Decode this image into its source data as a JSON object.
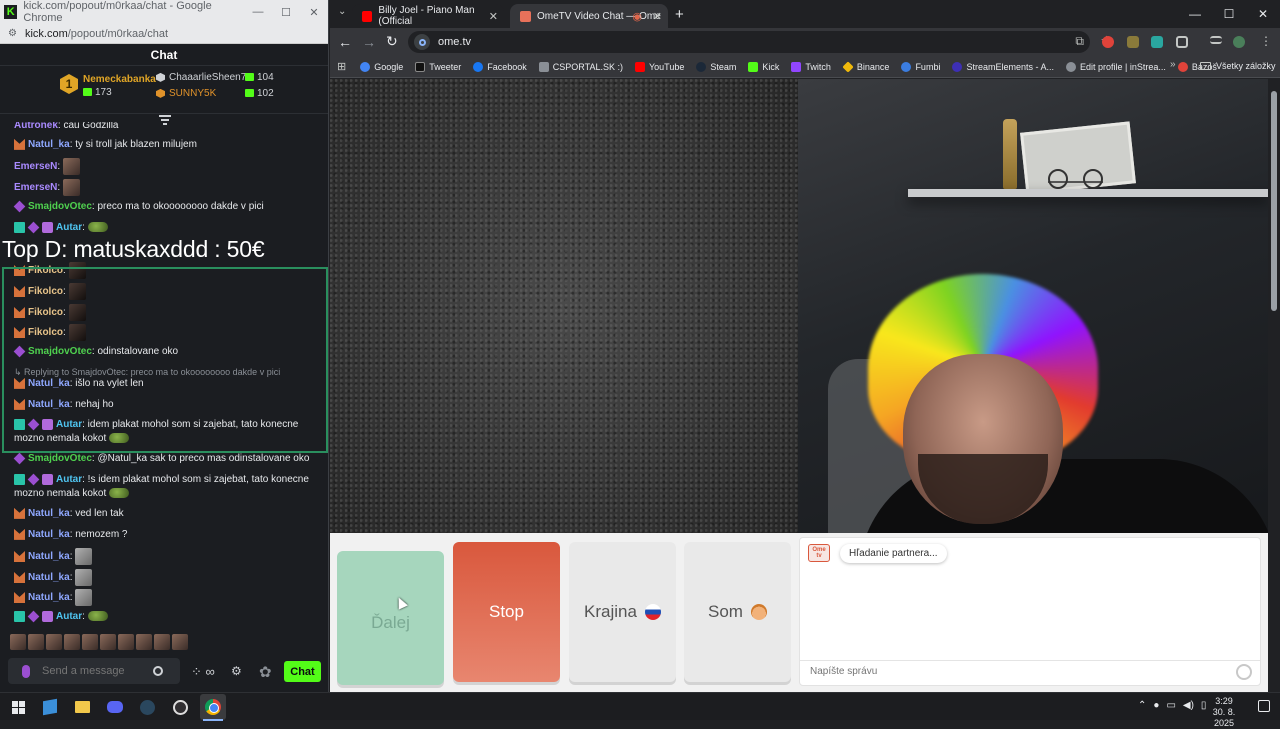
{
  "kick": {
    "window_title": "kick.com/popout/m0rkaa/chat - Google Chrome",
    "url_host": "kick.com",
    "url_path": "/popout/m0rkaa/chat",
    "header": "Chat",
    "leaderboard": {
      "rank": "1",
      "first_name": "Nemeckabanka",
      "first_count": "173",
      "second_name": "ChaaarlieSheen7",
      "second_count": "104",
      "third_name": "SUNNY5K",
      "third_count": "102"
    },
    "messages": [
      {
        "user": "Autronek",
        "sep": ":",
        "text": " cau Godzilla"
      },
      {
        "user": "Natul_ka",
        "sep": ":",
        "text": " ty si troll jak blazen milujem"
      },
      {
        "user": "EmerseN",
        "sep": ":",
        "text": ""
      },
      {
        "user": "EmerseN",
        "sep": ":",
        "text": ""
      },
      {
        "user": "SmajdovOtec",
        "sep": ":",
        "text": " preco ma to okoooooooo dakde v pici"
      },
      {
        "user": "Autar",
        "sep": ":",
        "text": ""
      },
      {
        "user": "Fikolco",
        "sep": ":",
        "text": ""
      },
      {
        "user": "Fikolco",
        "sep": ":",
        "text": ""
      },
      {
        "user": "Fikolco",
        "sep": ":",
        "text": ""
      },
      {
        "user": "Fikolco",
        "sep": ":",
        "text": ""
      },
      {
        "user": "SmajdovOtec",
        "sep": ":",
        "text": " odinstalovane oko"
      },
      {
        "reply": "Replying to SmajdovOtec: preco ma to okoooooooo dakde v pici"
      },
      {
        "user": "Natul_ka",
        "sep": ":",
        "text": " išlo na vylet len"
      },
      {
        "user": "Natul_ka",
        "sep": ":",
        "text": " nehaj ho"
      },
      {
        "user": "Autar",
        "sep": ":",
        "text": " idem plakat mohol som si zajebat, tato konecne mozno nemala kokot"
      },
      {
        "user": "SmajdovOtec",
        "sep": ":",
        "text": " @Natul_ka sak to preco mas odinstalovane oko"
      },
      {
        "user": "Autar",
        "sep": ":",
        "text": " !s idem plakat mohol som si zajebat, tato konecne mozno nemala kokot"
      },
      {
        "user": "Natul_ka",
        "sep": ":",
        "text": " ved len tak"
      },
      {
        "user": "Natul_ka",
        "sep": ":",
        "text": " nemozem ?"
      },
      {
        "user": "Natul_ka",
        "sep": ":",
        "text": ""
      },
      {
        "user": "Natul_ka",
        "sep": ":",
        "text": ""
      },
      {
        "user": "Natul_ka",
        "sep": ":",
        "text": ""
      },
      {
        "user": "Autar",
        "sep": ":",
        "text": ""
      }
    ],
    "overlay_text": "Top D: matuskaxddd : 50€",
    "composer_placeholder": "Send a message",
    "chat_button": "Chat"
  },
  "chrome": {
    "tabs": [
      {
        "label": "Billy Joel - Piano Man (Official "
      },
      {
        "label": "OmeTV Video Chat — Ome"
      }
    ],
    "url": "ome.tv",
    "bookmarks": [
      "Google",
      "Tweeter",
      "Facebook",
      "CSPORTAL.SK :)",
      "YouTube",
      "Steam",
      "Kick",
      "Twitch",
      "Binance",
      "Fumbi",
      "StreamElements - A...",
      "Edit profile | inStrea...",
      "Bazoš"
    ],
    "bookmarks_folder": "Všetky záložky"
  },
  "ometv": {
    "buttons": {
      "next": "Ďalej",
      "stop": "Stop",
      "country": "Krajina",
      "me": "Som"
    },
    "status_bubble": "Hľadanie partnera...",
    "logo": "Ome tv",
    "message_placeholder": "Napíšte správu"
  },
  "taskbar": {
    "time": "3:29",
    "date": "30. 8. 2025"
  },
  "colors": {
    "kick_green": "#53fc18",
    "stop_red": "#d9583d",
    "next_green": "#a6d6bd"
  }
}
